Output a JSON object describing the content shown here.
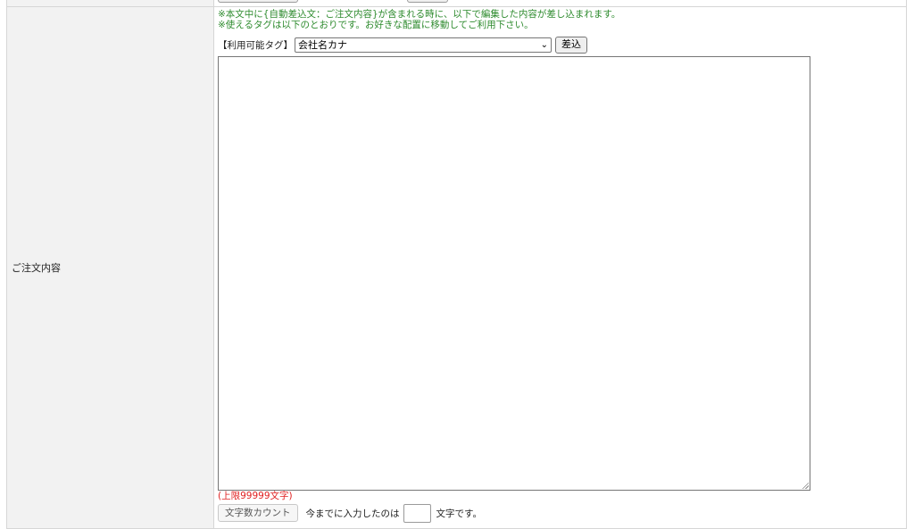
{
  "field": {
    "label": "ご注文内容"
  },
  "notes": {
    "line1": "※本文中に{自動差込文：ご注文内容}が含まれる時に、以下で編集した内容が差し込まれます。",
    "line2": "※使えるタグは以下のとおりです。お好きな配置に移動してご利用下さい。"
  },
  "tags": {
    "label": "【利用可能タグ】",
    "selected": "会社名カナ",
    "insert_label": "差込"
  },
  "editor": {
    "value": ""
  },
  "limit": {
    "text": "(上限99999文字)"
  },
  "counter": {
    "button_label": "文字数カウント",
    "prefix": "今までに入力したのは",
    "value": "",
    "suffix": "文字です。"
  },
  "colors": {
    "note": "#2e8b2e",
    "limit": "#e02020",
    "label_bg": "#f2f2f2",
    "border": "#d6d6d6"
  },
  "icons": {
    "select_arrow": "chevron-down-icon",
    "resize": "resize-grip-icon"
  }
}
